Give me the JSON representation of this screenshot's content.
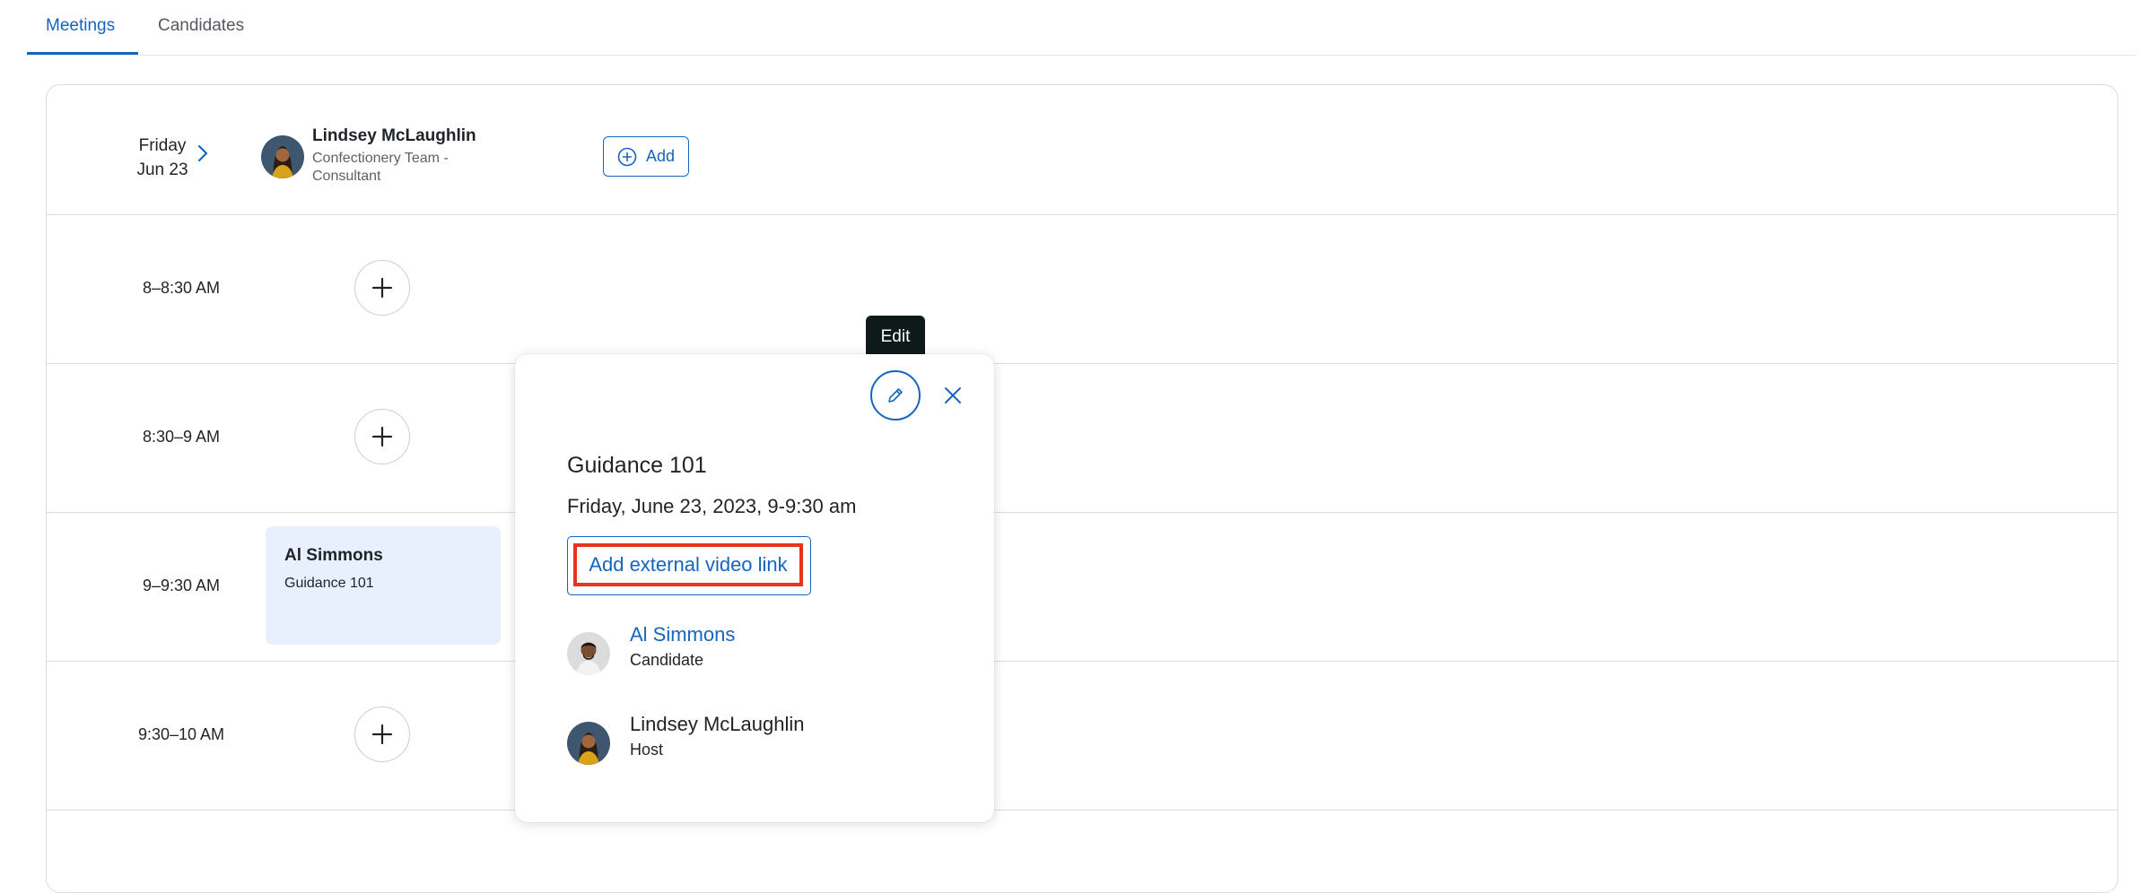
{
  "tabs": [
    {
      "label": "Meetings",
      "active": true
    },
    {
      "label": "Candidates",
      "active": false
    }
  ],
  "schedule": {
    "day": "Friday",
    "date": "Jun 23",
    "host": {
      "name": "Lindsey McLaughlin",
      "role": "Confectionery Team - Consultant"
    },
    "add_label": "Add",
    "slots": [
      {
        "time": "8–8:30 AM"
      },
      {
        "time": "8:30–9 AM"
      },
      {
        "time": "9–9:30 AM",
        "appointment": {
          "name": "Al Simmons",
          "title": "Guidance 101"
        }
      },
      {
        "time": "9:30–10 AM"
      }
    ]
  },
  "tooltip": {
    "text": "Edit"
  },
  "popover": {
    "title": "Guidance 101",
    "datetime": "Friday, June 23, 2023, 9-9:30 am",
    "video_link_label": "Add external video link",
    "participants": [
      {
        "name": "Al Simmons",
        "role": "Candidate"
      },
      {
        "name": "Lindsey McLaughlin",
        "role": "Host"
      }
    ]
  },
  "colors": {
    "accent": "#1565c0",
    "highlight": "#e8331e",
    "appointment_bg": "#e7f0fc",
    "tooltip_bg": "#0e1a1a"
  }
}
